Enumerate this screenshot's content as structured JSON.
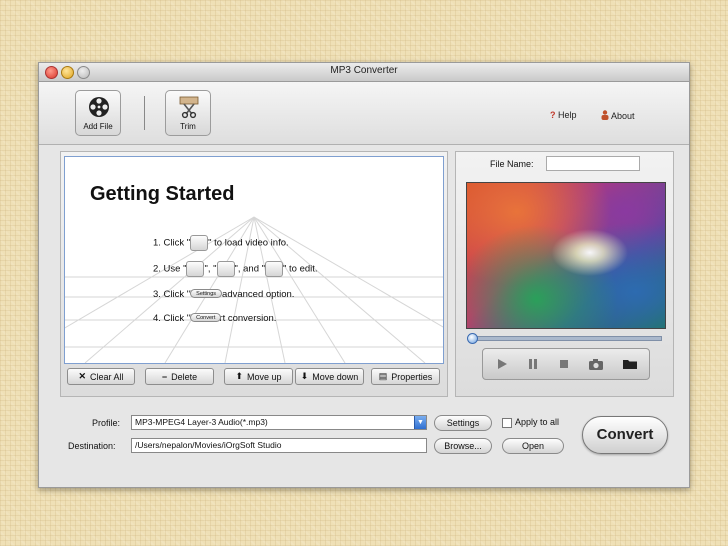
{
  "window": {
    "title": "MP3 Converter"
  },
  "toolbar": {
    "add_file_label": "Add File",
    "trim_label": "Trim",
    "help_label": "Help",
    "about_label": "About"
  },
  "preview": {
    "heading": "Getting Started",
    "step1_a": "1. Click \"",
    "step1_icon": "Add File",
    "step1_b": "\" to load video info.",
    "step2_a": "2. Use \"",
    "step2_icon1": "Trim",
    "step2_mid1": "\", \"",
    "step2_icon2": "Crop",
    "step2_mid2": "\", and \"",
    "step2_icon3": "Effect",
    "step2_b": "\" to edit.",
    "step3_a": "3. Click \"",
    "step3_btn": "Settings",
    "step3_b": "\" to set advanced option.",
    "step4_a": "4. Click \"",
    "step4_btn": "Convert",
    "step4_b": "\" to start conversion."
  },
  "list_buttons": {
    "clear_all": "Clear All",
    "delete": "Delete",
    "move_up": "Move up",
    "move_down": "Move down",
    "properties": "Properties"
  },
  "player": {
    "file_name_label": "File Name:",
    "file_name_value": "",
    "progress": 0
  },
  "output": {
    "profile_label": "Profile:",
    "profile_value": "MP3-MPEG4 Layer-3 Audio(*.mp3)",
    "settings_label": "Settings",
    "apply_to_all_label": "Apply to all",
    "apply_to_all_checked": false,
    "destination_label": "Destination:",
    "destination_value": "/Users/nepalon/Movies/iOrgSoft Studio",
    "browse_label": "Browse...",
    "open_label": "Open",
    "convert_label": "Convert"
  }
}
